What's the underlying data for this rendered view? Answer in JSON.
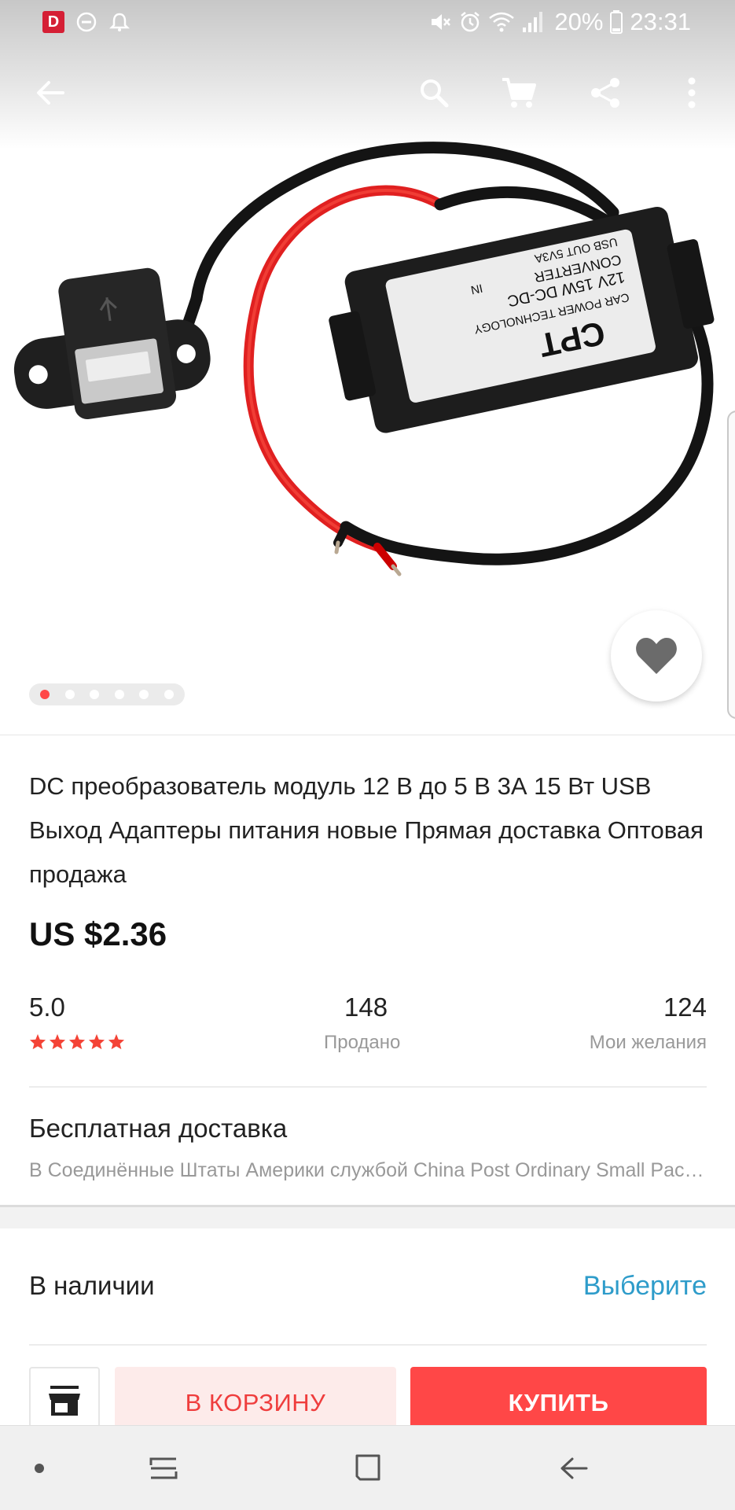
{
  "status_bar": {
    "app_badge": "D",
    "battery": "20%",
    "time": "23:31",
    "icons": [
      "dnd-icon",
      "notification-bell-icon",
      "mute-icon",
      "alarm-icon",
      "wifi-icon",
      "signal-icon",
      "battery-icon"
    ]
  },
  "toolbar": {
    "icons": [
      "back-arrow-icon",
      "search-icon",
      "cart-icon",
      "share-icon",
      "more-vert-icon"
    ]
  },
  "product_image": {
    "text": "CPT\nCAR POWER TECHNOLOGY\n12V 15W DC-DC CONVERTER\nIN\nUSB OUT 5V3A",
    "image_count": 6,
    "active_image": 1
  },
  "product": {
    "title": "DC преобразователь модуль 12 В до 5 В 3А 15 Вт USB Выход Адаптеры питания новые Прямая доставка Оптовая продажа",
    "price": "US $2.36",
    "rating": "5.0",
    "stars": 5,
    "sold_count": "148",
    "sold_label": "Продано",
    "wishlist_count": "124",
    "wishlist_label": "Мои желания"
  },
  "shipping": {
    "title": "Бесплатная доставка",
    "subtitle": "В Соединённые Штаты Америки службой China Post Ordinary Small Packet Plus"
  },
  "stock": {
    "label": "В наличии",
    "action": "Выберите"
  },
  "actions": {
    "add_to_cart": "В КОРЗИНУ",
    "buy": "КУПИТЬ"
  },
  "colors": {
    "accent_red": "#ff4747",
    "link_blue": "#2e9cca",
    "star_red": "#f44336"
  }
}
